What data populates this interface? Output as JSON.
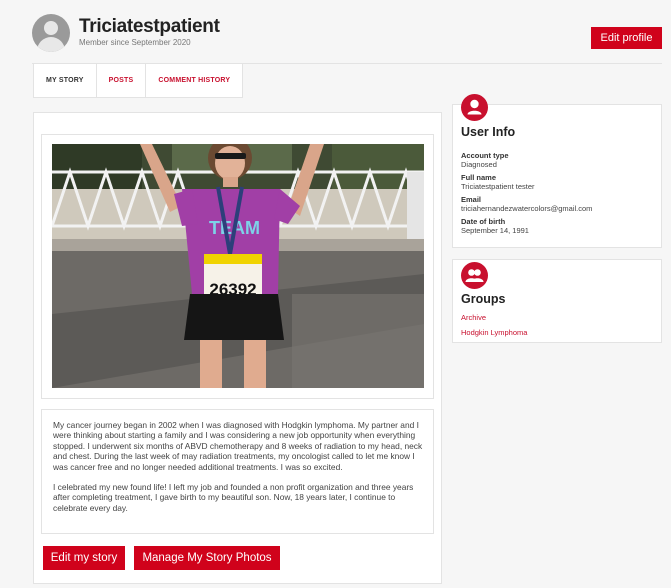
{
  "profile": {
    "username": "Triciatestpatient",
    "member_since": "Member since September 2020",
    "edit_profile_label": "Edit profile"
  },
  "tabs": [
    {
      "label": "MY STORY",
      "active": true
    },
    {
      "label": "POSTS",
      "active": false
    },
    {
      "label": "COMMENT HISTORY",
      "active": false
    }
  ],
  "story": {
    "photo": {
      "bib_number": "26392"
    },
    "paragraphs": [
      "My cancer journey began in 2002 when I was diagnosed with Hodgkin lymphoma.  My partner and I were thinking about starting a family and I was considering a new job opportunity when everything stopped.  I underwent six months of ABVD chemotherapy and 8 weeks of radiation to my head, neck and chest.  During the last week of may radiation treatments, my oncologist called to let me know I was cancer free and no longer needed additional treatments.  I was so excited.",
      "I celebrated my new found life! I left my job and founded a non profit organization and three years after completing treatment, I gave birth to my beautiful son.  Now, 18 years later, I continue to celebrate every day."
    ],
    "edit_label": "Edit my story",
    "manage_photos_label": "Manage My Story Photos"
  },
  "user_info": {
    "title": "User Info",
    "fields": [
      {
        "label": "Account type",
        "value": "Diagnosed"
      },
      {
        "label": "Full name",
        "value": "Triciatestpatient tester"
      },
      {
        "label": "Email",
        "value": "triciahernandezwatercolors@gmail.com"
      },
      {
        "label": "Date of birth",
        "value": "September 14, 1991"
      }
    ]
  },
  "groups": {
    "title": "Groups",
    "items": [
      "Archive",
      "Hodgkin Lymphoma"
    ]
  },
  "colors": {
    "accent": "#d0021b",
    "link": "#c8102e"
  }
}
